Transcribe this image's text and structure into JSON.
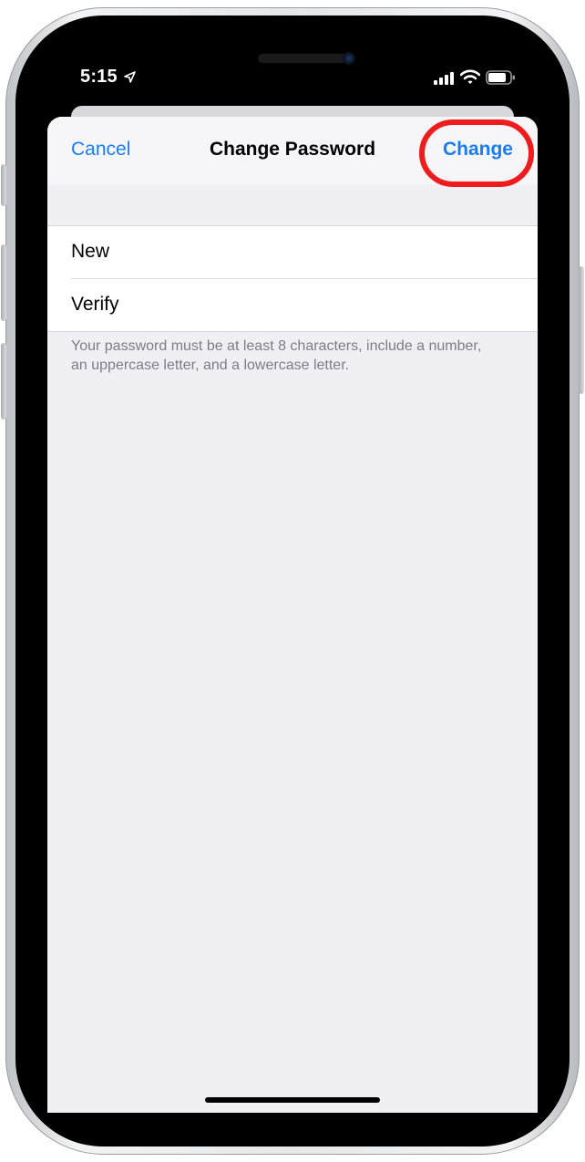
{
  "status_bar": {
    "time": "5:15",
    "icons": [
      "location-arrow-icon",
      "signal-icon",
      "wifi-icon",
      "battery-icon"
    ]
  },
  "nav": {
    "cancel_label": "Cancel",
    "title": "Change Password",
    "change_label": "Change"
  },
  "form": {
    "fields": [
      {
        "label": "New",
        "value": ""
      },
      {
        "label": "Verify",
        "value": ""
      }
    ],
    "footnote": "Your password must be at least 8 characters, include a number, an uppercase letter, and a lowercase letter."
  },
  "colors": {
    "accent": "#1b7cf2",
    "highlight": "#ee1c1c",
    "background": "#efeff4"
  }
}
